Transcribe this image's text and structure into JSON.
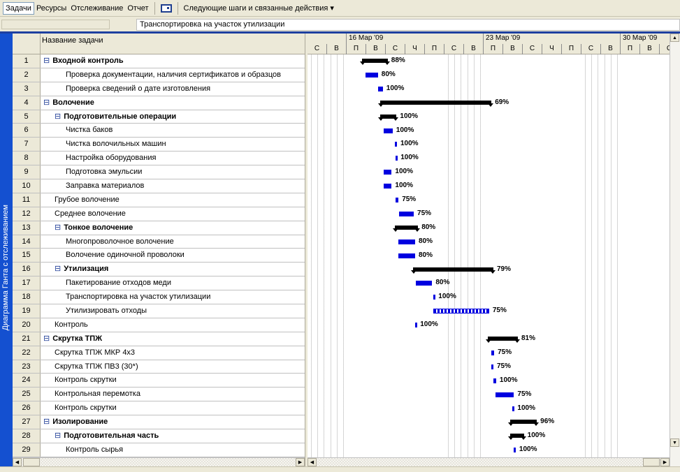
{
  "toolbar": {
    "tabs": [
      "Задачи",
      "Ресурсы",
      "Отслеживание",
      "Отчет"
    ],
    "next_steps": "Следующие шаги и связанные действия ▾"
  },
  "entry_bar": {
    "value": "Транспортировка на участок утилизации"
  },
  "view_label": "Диаграмма Ганта с отслеживанием",
  "table": {
    "name_header": "Название задачи",
    "rows": [
      {
        "id": "1",
        "name": "Входной контроль",
        "level": 0,
        "summary": true
      },
      {
        "id": "2",
        "name": "Проверка документации, наличия сертификатов и образцов",
        "level": 2,
        "summary": false
      },
      {
        "id": "3",
        "name": "Проверка сведений о дате изготовления",
        "level": 2,
        "summary": false
      },
      {
        "id": "4",
        "name": "Волочение",
        "level": 0,
        "summary": true
      },
      {
        "id": "5",
        "name": "Подготовительные операции",
        "level": 1,
        "summary": true
      },
      {
        "id": "6",
        "name": "Чистка баков",
        "level": 2,
        "summary": false
      },
      {
        "id": "7",
        "name": "Чистка волочильных машин",
        "level": 2,
        "summary": false
      },
      {
        "id": "8",
        "name": "Настройка оборудования",
        "level": 2,
        "summary": false
      },
      {
        "id": "9",
        "name": "Подготовка эмульсии",
        "level": 2,
        "summary": false
      },
      {
        "id": "10",
        "name": "Заправка материалов",
        "level": 2,
        "summary": false
      },
      {
        "id": "11",
        "name": "Грубое волочение",
        "level": 1,
        "summary": false
      },
      {
        "id": "12",
        "name": "Среднее волочение",
        "level": 1,
        "summary": false
      },
      {
        "id": "13",
        "name": "Тонкое волочение",
        "level": 1,
        "summary": true
      },
      {
        "id": "14",
        "name": "Многопроволочное волочение",
        "level": 2,
        "summary": false
      },
      {
        "id": "15",
        "name": "Волочение одиночной проволоки",
        "level": 2,
        "summary": false
      },
      {
        "id": "16",
        "name": "Утилизация",
        "level": 1,
        "summary": true
      },
      {
        "id": "17",
        "name": "Пакетирование отходов меди",
        "level": 2,
        "summary": false
      },
      {
        "id": "18",
        "name": "Транспортировка на участок утилизации",
        "level": 2,
        "summary": false
      },
      {
        "id": "19",
        "name": "Утилизировать отходы",
        "level": 2,
        "summary": false
      },
      {
        "id": "20",
        "name": "Контроль",
        "level": 1,
        "summary": false
      },
      {
        "id": "21",
        "name": "Скрутка ТПЖ",
        "level": 0,
        "summary": true
      },
      {
        "id": "22",
        "name": "Скрутка ТПЖ МКР 4х3",
        "level": 1,
        "summary": false
      },
      {
        "id": "23",
        "name": "Скрутка ТПЖ ПВ3 (30*)",
        "level": 1,
        "summary": false
      },
      {
        "id": "24",
        "name": "Контроль скрутки",
        "level": 1,
        "summary": false
      },
      {
        "id": "25",
        "name": "Контрольная перемотка",
        "level": 1,
        "summary": false
      },
      {
        "id": "26",
        "name": "Контроль скрутки",
        "level": 1,
        "summary": false
      },
      {
        "id": "27",
        "name": "Изолирование",
        "level": 0,
        "summary": true
      },
      {
        "id": "28",
        "name": "Подготовительная часть",
        "level": 1,
        "summary": true
      },
      {
        "id": "29",
        "name": "Контроль сырья",
        "level": 2,
        "summary": false
      }
    ]
  },
  "timescale": {
    "weeks": [
      {
        "label": "",
        "days": 2
      },
      {
        "label": "16 Мар '09",
        "days": 7
      },
      {
        "label": "23 Мар '09",
        "days": 7
      },
      {
        "label": "30 Мар '09",
        "days": 3
      }
    ],
    "days": [
      "С",
      "В",
      "П",
      "В",
      "С",
      "Ч",
      "П",
      "С",
      "В",
      "П",
      "В",
      "С",
      "Ч",
      "П",
      "С",
      "В",
      "П",
      "В",
      "С"
    ],
    "weekend_days": [
      0,
      1,
      7,
      8,
      14,
      15
    ]
  },
  "chart_data": {
    "type": "gantt",
    "unit": "days from Sat 14 Mar '09",
    "tasks": [
      {
        "start": 2.8,
        "dur": 1.3,
        "pct": "88%"
      },
      {
        "start": 2.95,
        "dur": 0.65,
        "pct": "80%"
      },
      {
        "start": 3.6,
        "dur": 0.25,
        "pct": "100%"
      },
      {
        "start": 3.7,
        "dur": 5.7,
        "pct": "69%"
      },
      {
        "start": 3.7,
        "dur": 0.85,
        "pct": "100%"
      },
      {
        "start": 3.9,
        "dur": 0.45,
        "pct": "100%"
      },
      {
        "start": 4.45,
        "dur": 0.12,
        "pct": "100%"
      },
      {
        "start": 4.5,
        "dur": 0.08,
        "pct": "100%"
      },
      {
        "start": 3.9,
        "dur": 0.4,
        "pct": "100%"
      },
      {
        "start": 3.9,
        "dur": 0.4,
        "pct": "100%"
      },
      {
        "start": 4.5,
        "dur": 0.15,
        "pct": "75%"
      },
      {
        "start": 4.68,
        "dur": 0.75,
        "pct": "75%"
      },
      {
        "start": 4.45,
        "dur": 1.2,
        "pct": "80%"
      },
      {
        "start": 4.65,
        "dur": 0.85,
        "pct": "80%"
      },
      {
        "start": 4.65,
        "dur": 0.85,
        "pct": "80%"
      },
      {
        "start": 5.4,
        "dur": 4.1,
        "pct": "79%"
      },
      {
        "start": 5.55,
        "dur": 0.82,
        "pct": "80%"
      },
      {
        "start": 6.43,
        "dur": 0.08,
        "pct": "100%"
      },
      {
        "start": 6.43,
        "dur": 2.85,
        "pct": "75%",
        "striped": true
      },
      {
        "start": 5.5,
        "dur": 0.08,
        "pct": "100%"
      },
      {
        "start": 9.2,
        "dur": 1.55,
        "pct": "81%"
      },
      {
        "start": 9.4,
        "dur": 0.14,
        "pct": "75%"
      },
      {
        "start": 9.4,
        "dur": 0.1,
        "pct": "75%"
      },
      {
        "start": 9.5,
        "dur": 0.14,
        "pct": "100%"
      },
      {
        "start": 9.6,
        "dur": 0.95,
        "pct": "75%"
      },
      {
        "start": 10.45,
        "dur": 0.1,
        "pct": "100%"
      },
      {
        "start": 10.36,
        "dur": 1.36,
        "pct": "96%"
      },
      {
        "start": 10.36,
        "dur": 0.7,
        "pct": "100%"
      },
      {
        "start": 10.54,
        "dur": 0.1,
        "pct": "100%"
      }
    ]
  }
}
